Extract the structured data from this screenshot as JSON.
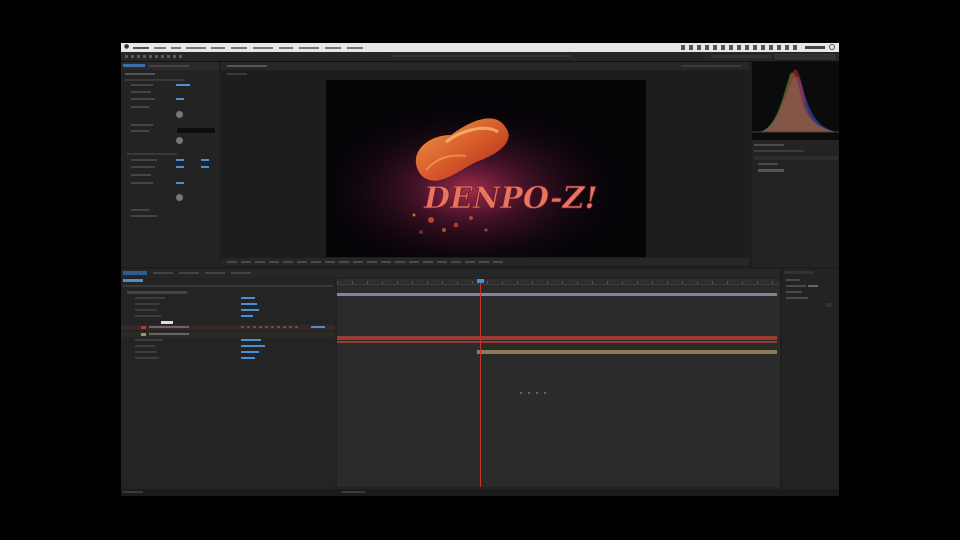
{
  "preview": {
    "title_text": "DENPO-Z!"
  },
  "colors": {
    "layer_bar_red": "#9a3a33",
    "layer_bar_tan": "#8a7a55",
    "work_area_bar": "#7d8799",
    "playhead": "#c0392b",
    "menubar_bg": "#e8e6e6",
    "panel_bg": "#232323",
    "property_value_blue": "#4a8fd6",
    "histogram_colors": [
      "#d93030",
      "#40c040",
      "#3060e0"
    ]
  },
  "icons": {
    "apple": "apple-icon",
    "menubar_status": "status-icons",
    "search": "search-icon"
  }
}
